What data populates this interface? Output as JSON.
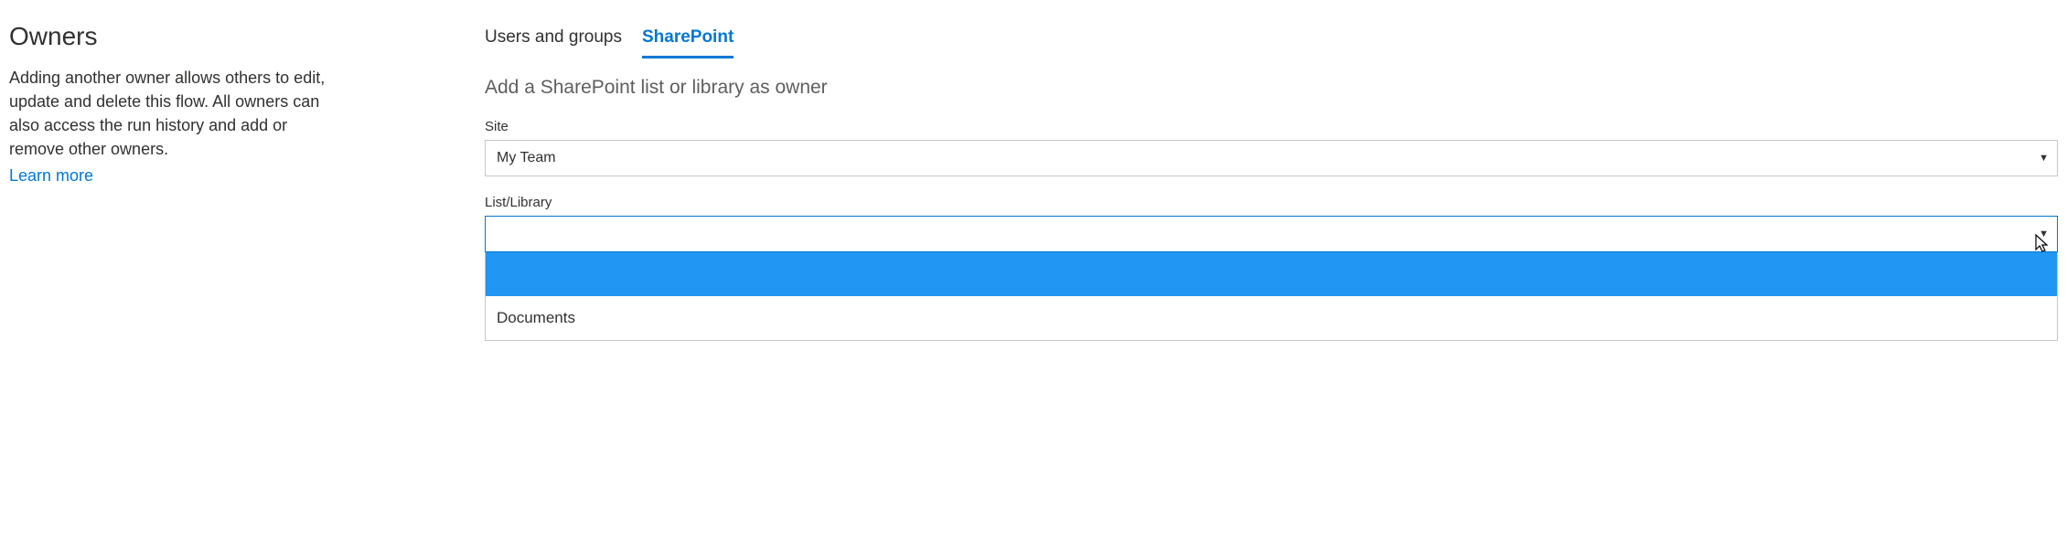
{
  "leftPanel": {
    "title": "Owners",
    "description": "Adding another owner allows others to edit, update and delete this flow. All owners can also access the run history and add or remove other owners.",
    "learnMore": "Learn more"
  },
  "tabs": {
    "items": [
      {
        "label": "Users and groups",
        "active": false
      },
      {
        "label": "SharePoint",
        "active": true
      }
    ]
  },
  "subHeading": "Add a SharePoint list or library as owner",
  "siteField": {
    "label": "Site",
    "value": "My Team"
  },
  "listLibraryField": {
    "label": "List/Library",
    "value": "",
    "options": [
      {
        "label": "",
        "highlighted": true
      },
      {
        "label": "Documents",
        "highlighted": false
      }
    ]
  }
}
